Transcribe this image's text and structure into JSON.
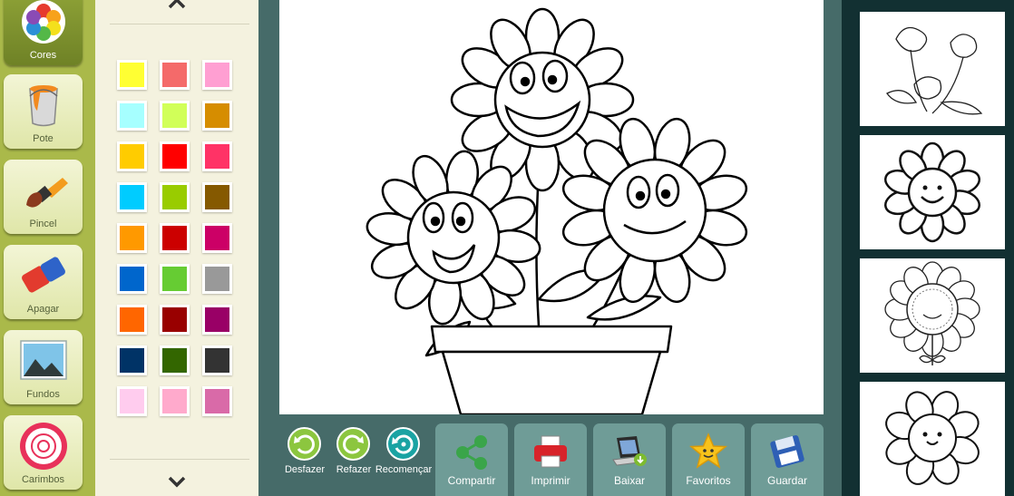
{
  "toolbar": {
    "tools": [
      {
        "id": "cores",
        "label": "Cores",
        "active": true
      },
      {
        "id": "pote",
        "label": "Pote"
      },
      {
        "id": "pincel",
        "label": "Pincel"
      },
      {
        "id": "apagar",
        "label": "Apagar"
      },
      {
        "id": "fundos",
        "label": "Fundos"
      },
      {
        "id": "carimbos",
        "label": "Carimbos"
      }
    ]
  },
  "palette": {
    "up_icon": "chevron-up-icon",
    "down_icon": "chevron-down-icon",
    "colors": [
      [
        "#ffff33",
        "#f46a6a",
        "#ff9fd2"
      ],
      [
        "#a6ffff",
        "#d1ff59",
        "#d68d00"
      ],
      [
        "#ffcc00",
        "#ff0000",
        "#ff3366"
      ],
      [
        "#00ccff",
        "#99cc00",
        "#855900"
      ],
      [
        "#ff9900",
        "#cc0000",
        "#cc0066"
      ],
      [
        "#0066cc",
        "#66cc33",
        "#999999"
      ],
      [
        "#ff6600",
        "#990000",
        "#990066"
      ],
      [
        "#003366",
        "#336600",
        "#333333"
      ],
      [
        "#ffccee",
        "#ffaacc",
        "#d96aa8"
      ]
    ]
  },
  "actions": {
    "round": [
      {
        "id": "desfazer",
        "label": "Desfazer",
        "color": "#8cc63f"
      },
      {
        "id": "refazer",
        "label": "Refazer",
        "color": "#8cc63f"
      },
      {
        "id": "recomencar",
        "label": "Recomençar",
        "color": "#1aa3a3"
      }
    ],
    "big": [
      {
        "id": "compartir",
        "label": "Compartir"
      },
      {
        "id": "imprimir",
        "label": "Imprimir"
      },
      {
        "id": "baixar",
        "label": "Baixar"
      },
      {
        "id": "favoritos",
        "label": "Favoritos"
      },
      {
        "id": "guardar",
        "label": "Guardar"
      }
    ]
  },
  "gallery": {
    "thumbnails": [
      {
        "id": "poppies"
      },
      {
        "id": "smiling-flower"
      },
      {
        "id": "mandala-flower"
      },
      {
        "id": "cute-flower"
      }
    ]
  }
}
